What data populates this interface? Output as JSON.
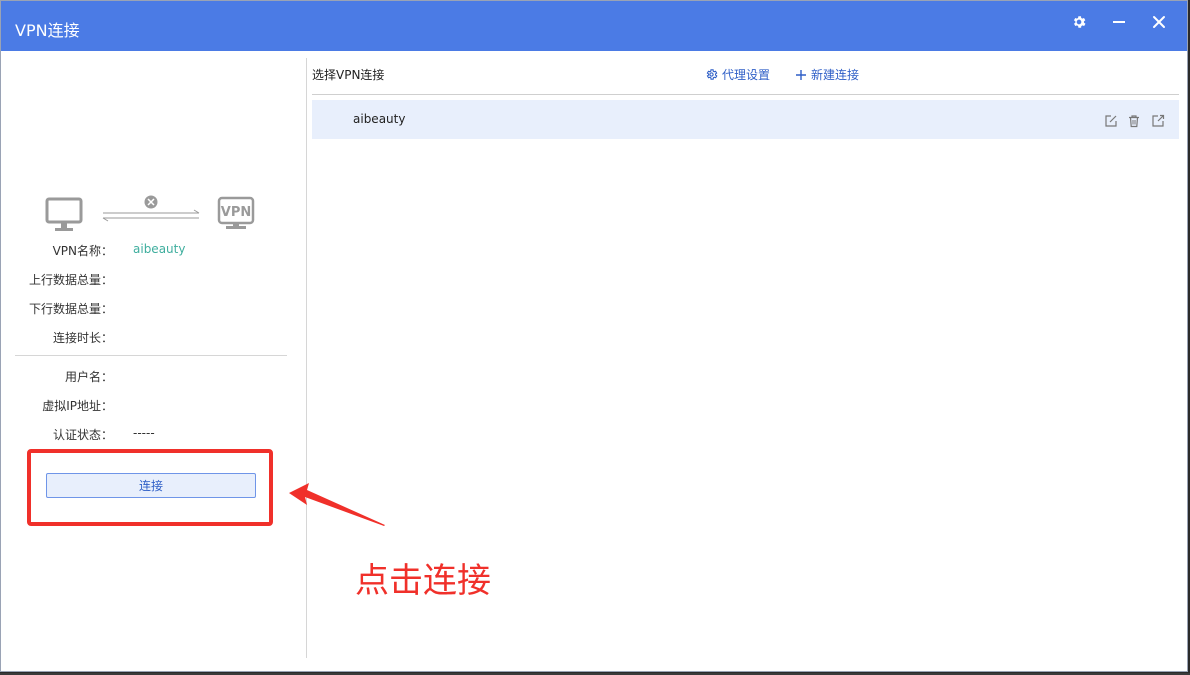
{
  "window": {
    "title": "VPN连接"
  },
  "titlebar_icons": {
    "settings": "gear-icon",
    "minimize": "minimize-icon",
    "close": "close-icon"
  },
  "left_panel": {
    "diagram": {
      "left_icon": "monitor-icon",
      "status_icon": "disconnected-x-icon",
      "right_icon_text": "VPN"
    },
    "vpn_info": [
      {
        "label": "VPN名称：",
        "value": "aibeauty"
      },
      {
        "label": "上行数据总量：",
        "value": ""
      },
      {
        "label": "下行数据总量：",
        "value": ""
      },
      {
        "label": "连接时长：",
        "value": ""
      }
    ],
    "user_info": [
      {
        "label": "用户名：",
        "value": ""
      },
      {
        "label": "虚拟IP地址：",
        "value": ""
      },
      {
        "label": "认证状态：",
        "value": "-----"
      }
    ],
    "connect_button": "连接"
  },
  "right_panel": {
    "title": "选择VPN连接",
    "proxy_settings": "代理设置",
    "new_connection": "新建连接",
    "connections": [
      {
        "name": "aibeauty"
      }
    ],
    "row_icons": [
      "edit-icon",
      "delete-icon",
      "export-icon"
    ]
  },
  "annotation": {
    "text": "点击连接"
  },
  "colors": {
    "titlebar": "#4b7be5",
    "accent": "#2f5fc7",
    "vpn_name_value": "#3fae9e",
    "annotation_red": "#f0302a",
    "row_highlight": "#e8effc"
  }
}
